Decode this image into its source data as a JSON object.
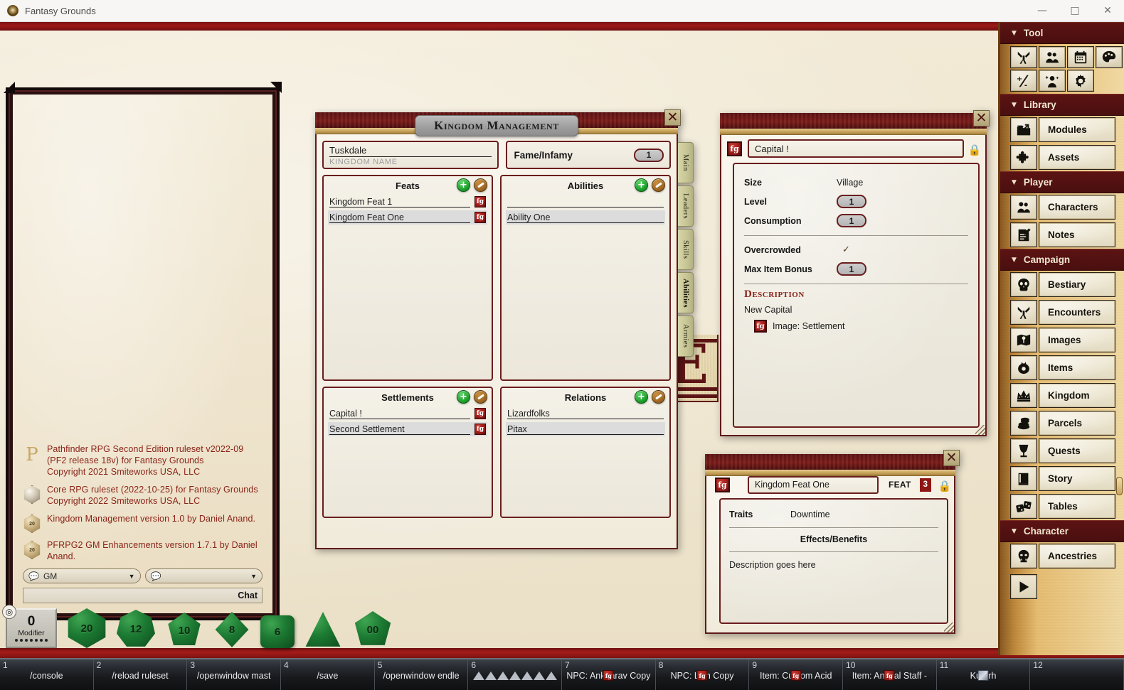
{
  "window": {
    "app_title": "Fantasy Grounds",
    "app_icon": "fantasy-grounds-logo-icon",
    "minimize": "—",
    "maximize": "□",
    "close": "✕"
  },
  "chat": {
    "messages": [
      {
        "icon": "pathfinder-glyph-icon",
        "text": "Pathfinder RPG Second Edition ruleset v2022-09 (PF2 release 18v) for Fantasy Grounds\nCopyright 2021 Smiteworks USA, LLC"
      },
      {
        "icon": "d20-crystal-icon",
        "text": "Core RPG ruleset (2022-10-25) for Fantasy Grounds\nCopyright 2022 Smiteworks USA, LLC"
      },
      {
        "icon": "d20-gold-icon",
        "text": "Kingdom Management version 1.0 by Daniel Anand."
      },
      {
        "icon": "d20-gold-icon",
        "text": "PFRPG2 GM Enhancements version 1.7.1 by Daniel Anand."
      }
    ],
    "speaker_select": "GM",
    "mode_select": "",
    "entry_value": "",
    "chat_button": "Chat"
  },
  "kingdom_window": {
    "title": "Kingdom Management",
    "close_label": "✕",
    "kingdom_name_value": "Tuskdale",
    "kingdom_name_placeholder": "KINGDOM NAME",
    "fame_label": "Fame/Infamy",
    "fame_value": "1",
    "side_tabs": [
      {
        "label": "Main",
        "active": false
      },
      {
        "label": "Leaders",
        "active": false
      },
      {
        "label": "Skills",
        "active": false
      },
      {
        "label": "Abilities",
        "active": true
      },
      {
        "label": "Armies",
        "active": false
      }
    ],
    "panels": [
      {
        "title": "Feats",
        "add_label": "+",
        "edit_label": "edit",
        "items": [
          {
            "name": "Kingdom Feat 1",
            "link": true,
            "alt": false
          },
          {
            "name": "Kingdom Feat One",
            "link": true,
            "alt": true
          }
        ]
      },
      {
        "title": "Abilities",
        "add_label": "+",
        "edit_label": "edit",
        "items": [
          {
            "name": "",
            "link": false,
            "alt": false
          },
          {
            "name": "Ability One",
            "link": false,
            "alt": true
          }
        ]
      },
      {
        "title": "Settlements",
        "add_label": "+",
        "edit_label": "edit",
        "items": [
          {
            "name": "Capital !",
            "link": true,
            "alt": false
          },
          {
            "name": "Second Settlement",
            "link": true,
            "alt": true
          }
        ]
      },
      {
        "title": "Relations",
        "add_label": "+",
        "edit_label": "edit",
        "items": [
          {
            "name": "Lizardfolks",
            "link": false,
            "alt": false
          },
          {
            "name": "Pitax",
            "link": false,
            "alt": true
          }
        ]
      }
    ]
  },
  "settlement_window": {
    "close_label": "✕",
    "record_icon": "settlement-link-icon",
    "name_value": "Capital !",
    "lock_icon": "lock-icon",
    "attributes": [
      {
        "label": "Size",
        "value": "Village",
        "type": "text"
      },
      {
        "label": "Level",
        "value": "1",
        "type": "number"
      },
      {
        "label": "Consumption",
        "value": "1",
        "type": "number"
      },
      {
        "label": "Overcrowded",
        "value": "✓",
        "type": "check"
      },
      {
        "label": "Max Item Bonus",
        "value": "1",
        "type": "number"
      }
    ],
    "description_title": "Description",
    "description_text": "New Capital",
    "description_link": {
      "icon": "image-link-icon",
      "text": "Image: Settlement"
    }
  },
  "feat_window": {
    "close_label": "✕",
    "record_icon": "feat-link-icon",
    "name_value": "Kingdom Feat One",
    "type_tag": "FEAT",
    "level_badge": "3",
    "lock_icon": "lock-icon",
    "traits_label": "Traits",
    "traits_value": "Downtime",
    "effects_header": "Effects/Benefits",
    "effects_text": "Description goes here"
  },
  "sidebar": {
    "sections": [
      {
        "label": "Tool",
        "type": "tools",
        "tools": [
          {
            "icon": "crossed-swords-icon"
          },
          {
            "icon": "party-group-icon"
          },
          {
            "icon": "calendar-icon"
          },
          {
            "icon": "color-palette-icon"
          },
          {
            "icon": "plus-minus-modifier-icon"
          },
          {
            "icon": "character-sparkle-icon"
          },
          {
            "icon": "gear-icon"
          }
        ]
      },
      {
        "label": "Library",
        "type": "list",
        "items": [
          {
            "label": "Modules",
            "icon": "folder-open-icon"
          },
          {
            "label": "Assets",
            "icon": "puzzle-piece-icon"
          }
        ]
      },
      {
        "label": "Player",
        "type": "list",
        "items": [
          {
            "label": "Characters",
            "icon": "party-group-icon"
          },
          {
            "label": "Notes",
            "icon": "note-pencil-icon"
          }
        ]
      },
      {
        "label": "Campaign",
        "type": "list",
        "items": [
          {
            "label": "Bestiary",
            "icon": "skull-icon"
          },
          {
            "label": "Encounters",
            "icon": "crossed-swords-icon"
          },
          {
            "label": "Images",
            "icon": "map-pin-icon"
          },
          {
            "label": "Items",
            "icon": "coin-pouch-icon"
          },
          {
            "label": "Kingdom",
            "icon": "crown-icon"
          },
          {
            "label": "Parcels",
            "icon": "coin-stack-icon"
          },
          {
            "label": "Quests",
            "icon": "goblet-icon"
          },
          {
            "label": "Story",
            "icon": "book-icon"
          },
          {
            "label": "Tables",
            "icon": "dice-tables-icon"
          }
        ]
      },
      {
        "label": "Character",
        "type": "list",
        "items": [
          {
            "label": "Ancestries",
            "icon": "orc-head-icon"
          }
        ]
      }
    ],
    "play_button_icon": "play-triangle-icon",
    "collapse_triangle": "▼"
  },
  "dice_tray": {
    "modifier_label": "Modifier",
    "modifier_value": "0",
    "target_icon": "crosshair-icon",
    "dice": [
      {
        "face": "20",
        "type": "d20"
      },
      {
        "face": "12",
        "type": "d12"
      },
      {
        "face": "10",
        "type": "d10"
      },
      {
        "face": "8",
        "type": "d8"
      },
      {
        "face": "6",
        "type": "d6"
      },
      {
        "face": "",
        "type": "d4"
      },
      {
        "face": "00",
        "type": "d100"
      }
    ]
  },
  "hotbar": {
    "slots": [
      {
        "index": "1",
        "text": "/console",
        "icon": ""
      },
      {
        "index": "2",
        "text": "/reload ruleset",
        "icon": ""
      },
      {
        "index": "3",
        "text": "/openwindow mast",
        "icon": ""
      },
      {
        "index": "4",
        "text": "/save",
        "icon": ""
      },
      {
        "index": "5",
        "text": "/openwindow endle",
        "icon": ""
      },
      {
        "index": "6",
        "text": "",
        "icon": "d4-row-icon"
      },
      {
        "index": "7",
        "text": "NPC: Ankharav Copy",
        "icon": "npc-link-icon"
      },
      {
        "index": "8",
        "text": "NPC: Lich Copy",
        "icon": "npc-link-icon"
      },
      {
        "index": "9",
        "text": "Item: Custom Acid",
        "icon": "item-link-icon"
      },
      {
        "index": "10",
        "text": "Item: Animal Staff -",
        "icon": "item-link-icon"
      },
      {
        "index": "11",
        "text": "Kutarh",
        "icon": "portrait-icon"
      },
      {
        "index": "12",
        "text": "",
        "icon": ""
      }
    ]
  },
  "colors": {
    "accent_red": "#8a2418",
    "frame_red": "#6a1d1d",
    "parchment": "#f2ead6",
    "gold": "#e6bd72",
    "dice_green": "#1c7a32",
    "sidebar_header": "#5c1313"
  }
}
